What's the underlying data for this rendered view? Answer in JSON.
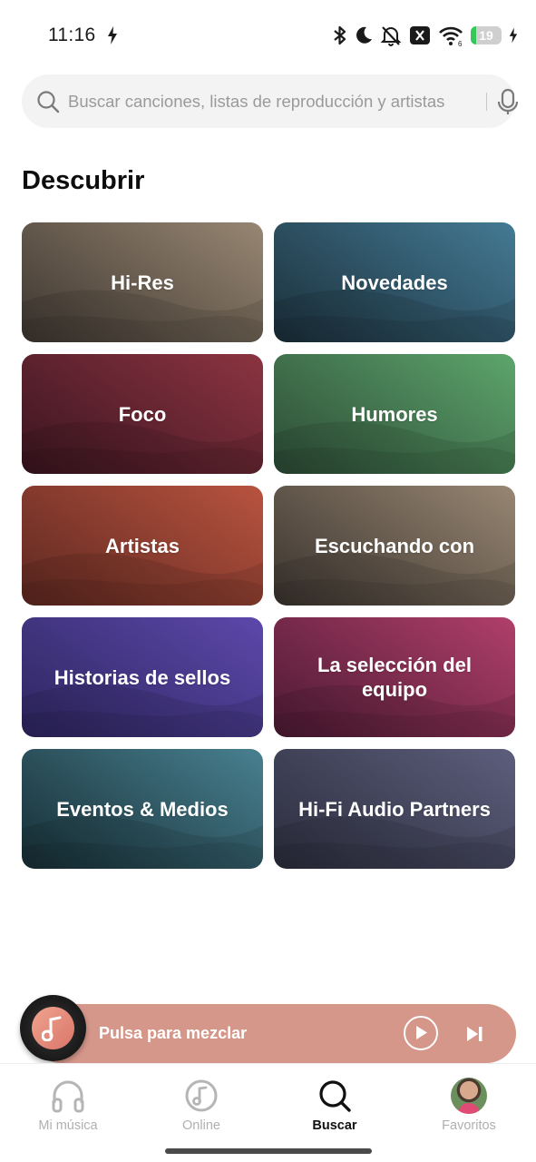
{
  "status_bar": {
    "time": "11:16",
    "battery_level": "19",
    "battery_fraction": 0.19,
    "battery_color": "#34c759"
  },
  "search": {
    "placeholder": "Buscar canciones, listas de reproducción y artistas",
    "icon": "search-icon",
    "voice_icon": "microphone-icon"
  },
  "discover": {
    "title": "Descubrir",
    "tiles": [
      {
        "label": "Hi-Res",
        "colors": [
          "#3d3630",
          "#978672"
        ]
      },
      {
        "label": "Novedades",
        "colors": [
          "#1b2f3a",
          "#447a94"
        ]
      },
      {
        "label": "Foco",
        "colors": [
          "#3a1520",
          "#8c3441"
        ]
      },
      {
        "label": "Humores",
        "colors": [
          "#2c4a35",
          "#5da56c"
        ]
      },
      {
        "label": "Artistas",
        "colors": [
          "#5e2820",
          "#b8533f"
        ]
      },
      {
        "label": "Escuchando con",
        "colors": [
          "#3a332e",
          "#978672"
        ]
      },
      {
        "label": "Historias de sellos",
        "colors": [
          "#2e2660",
          "#5c48aa"
        ]
      },
      {
        "label": "La selección del equipo",
        "colors": [
          "#4c1a33",
          "#b03f6a"
        ]
      },
      {
        "label": "Eventos & Medios",
        "colors": [
          "#172e35",
          "#488090"
        ]
      },
      {
        "label": "Hi-Fi Audio Partners",
        "colors": [
          "#2c2d3d",
          "#5c5e7c"
        ]
      }
    ]
  },
  "mini_player": {
    "label": "Pulsa para mezclar",
    "background": "#d6978b",
    "play_icon": "play-icon",
    "next_icon": "skip-next-icon"
  },
  "bottom_nav": {
    "items": [
      {
        "label": "Mi música",
        "icon": "headphones-icon",
        "active": false
      },
      {
        "label": "Online",
        "icon": "music-disc-icon",
        "active": false
      },
      {
        "label": "Buscar",
        "icon": "search-icon",
        "active": true
      },
      {
        "label": "Favoritos",
        "icon": "avatar",
        "active": false
      }
    ]
  }
}
